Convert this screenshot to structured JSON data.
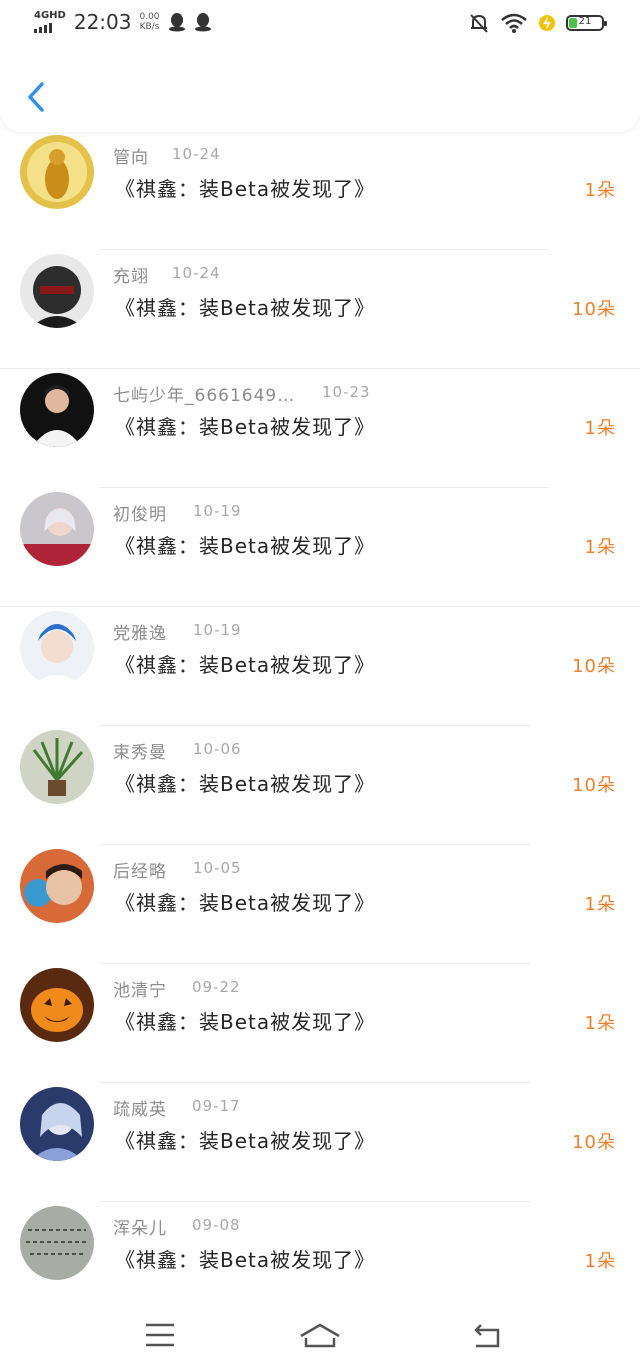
{
  "status_bar": {
    "network": "4GHD",
    "time": "22:03",
    "speed_value": "0.00",
    "speed_unit": "KB/s",
    "battery_level": "21",
    "colors": {
      "battery_fill": "#4cc34a",
      "charging": "#f2c200"
    }
  },
  "header": {
    "back_icon": "chevron-left-icon",
    "accent": "#2f8ef2"
  },
  "items": [
    {
      "name": "管向",
      "date": "10-24",
      "message": "《祺鑫：装Beta被发现了》",
      "amount": "1朵"
    },
    {
      "name": "充翊",
      "date": "10-24",
      "message": "《祺鑫：装Beta被发现了》",
      "amount": "10朵"
    },
    {
      "name": "七屿少年_6661649…",
      "date": "10-23",
      "message": "《祺鑫：装Beta被发现了》",
      "amount": "1朵"
    },
    {
      "name": "初俊明",
      "date": "10-19",
      "message": "《祺鑫：装Beta被发现了》",
      "amount": "1朵"
    },
    {
      "name": "党雅逸",
      "date": "10-19",
      "message": "《祺鑫：装Beta被发现了》",
      "amount": "10朵"
    },
    {
      "name": "束秀曼",
      "date": "10-06",
      "message": "《祺鑫：装Beta被发现了》",
      "amount": "10朵"
    },
    {
      "name": "后经略",
      "date": "10-05",
      "message": "《祺鑫：装Beta被发现了》",
      "amount": "1朵"
    },
    {
      "name": "池清宁",
      "date": "09-22",
      "message": "《祺鑫：装Beta被发现了》",
      "amount": "1朵"
    },
    {
      "name": "疏威英",
      "date": "09-17",
      "message": "《祺鑫：装Beta被发现了》",
      "amount": "10朵"
    },
    {
      "name": "浑朵儿",
      "date": "09-08",
      "message": "《祺鑫：装Beta被发现了》",
      "amount": "1朵"
    }
  ],
  "colors": {
    "amount": "#f07f2c",
    "meta": "#8d8d8d"
  },
  "nav": {
    "menu_icon": "menu-icon",
    "home_icon": "home-icon",
    "back_icon": "return-icon"
  }
}
